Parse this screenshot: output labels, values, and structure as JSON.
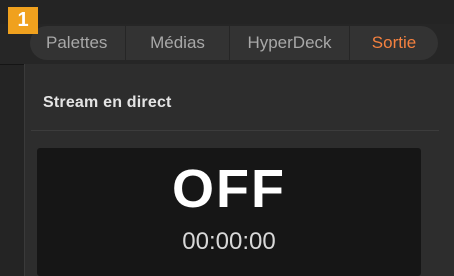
{
  "badge": "1",
  "tabs": [
    {
      "label": "Palettes",
      "active": false
    },
    {
      "label": "Médias",
      "active": false
    },
    {
      "label": "HyperDeck",
      "active": false
    },
    {
      "label": "Sortie",
      "active": true
    }
  ],
  "stream": {
    "section_title": "Stream en direct",
    "status": "OFF",
    "timecode": "00:00:00"
  },
  "colors": {
    "active_tab": "#f5813f",
    "badge": "#f0a11e",
    "background": "#242424",
    "display": "#161616"
  }
}
